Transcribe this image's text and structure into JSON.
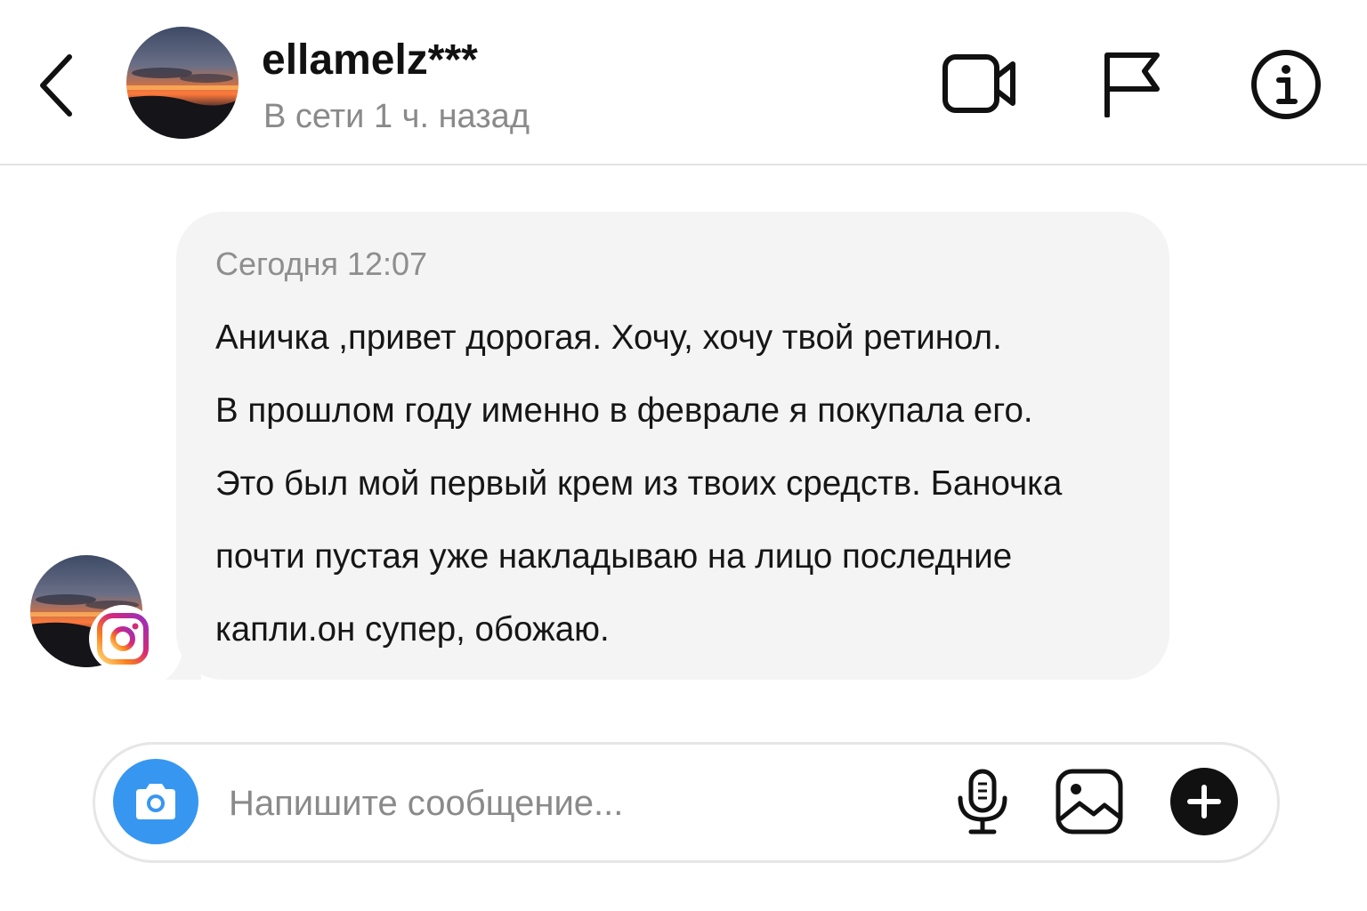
{
  "header": {
    "username": "ellamelz***",
    "status": "В сети 1 ч. назад",
    "icons": [
      "back-arrow-icon",
      "video-call-icon",
      "flag-icon",
      "info-icon"
    ]
  },
  "message": {
    "time": "Сегодня 12:07",
    "lines": [
      "Аничка ,привет дорогая. Хочу, хочу твой ретинол.",
      "В прошлом году именно в феврале я покупала его.",
      "Это был мой первый крем из твоих средств. Баночка",
      "почти пустая уже накладываю на лицо последние",
      "капли.он супер, обожаю."
    ],
    "badge_icon": "instagram-icon"
  },
  "composer": {
    "placeholder": "Напишите сообщение...",
    "icons": [
      "camera-icon",
      "microphone-icon",
      "gallery-icon",
      "plus-icon"
    ]
  },
  "colors": {
    "accent_blue": "#3797f0",
    "bubble_bg": "#f4f4f4",
    "secondary_text": "#8a8a8a",
    "divider": "#e3e3e3"
  }
}
